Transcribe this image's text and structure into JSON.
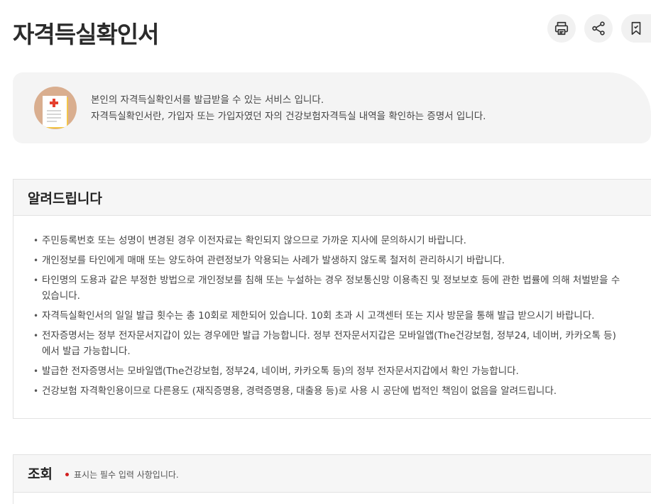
{
  "page": {
    "title": "자격득실확인서"
  },
  "actions": {
    "print_icon": "print-icon",
    "share_icon": "share-icon",
    "bookmark_icon": "bookmark-icon"
  },
  "intro": {
    "icon": "document-icon",
    "line1": "본인의 자격득실확인서를 발급받을 수 있는 서비스 입니다.",
    "line2": "자격득실확인서란, 가입자 또는 가입자였던 자의 건강보험자격득실 내역을 확인하는 증명서 입니다."
  },
  "notice": {
    "title": "알려드립니다",
    "items": [
      "주민등록번호 또는 성명이 변경된 경우 이전자료는 확인되지 않으므로 가까운 지사에 문의하시기 바랍니다.",
      "개인정보를 타인에게 매매 또는 양도하여 관련정보가 악용되는 사례가 발생하지 않도록 철저히 관리하시기 바랍니다.",
      "타인명의 도용과 같은 부정한 방법으로 개인정보를 침해 또는 누설하는 경우 정보통신망 이용촉진 및 정보보호 등에 관한 법률에 의해 처벌받을 수 있습니다.",
      "자격득실확인서의 일일 발급 횟수는 총 10회로 제한되어 있습니다. 10회 초과 시 고객센터 또는 지사 방문을 통해 발급 받으시기 바랍니다.",
      "전자증명서는 정부 전자문서지갑이 있는 경우에만 발급 가능합니다. 정부 전자문서지갑은 모바일앱(The건강보험, 정부24, 네이버, 카카오톡 등)에서 발급 가능합니다.",
      "발급한 전자증명서는 모바일앱(The건강보험, 정부24, 네이버, 카카오톡 등)의 정부 전자문서지갑에서 확인 가능합니다.",
      "건강보험 자격확인용이므로 다른용도 (재직증명용, 경력증명용, 대출용 등)로 사용 시 공단에 법적인 책임이 없음을 알려드립니다."
    ]
  },
  "query": {
    "title": "조회",
    "required_note": "표시는 필수 입력 사항입니다.",
    "required_color": "#d21f1f"
  }
}
